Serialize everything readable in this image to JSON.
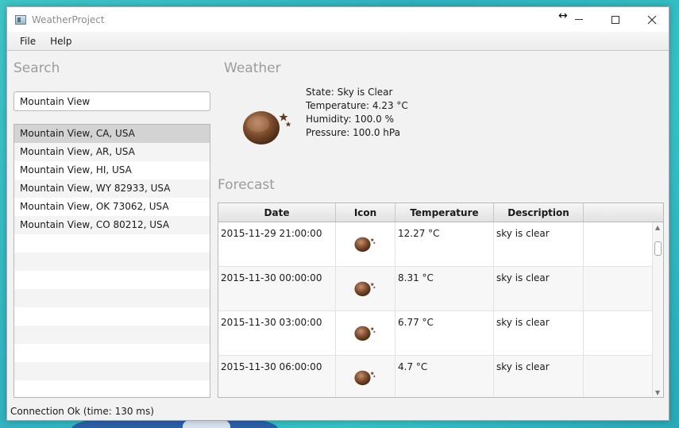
{
  "window": {
    "title": "WeatherProject",
    "resize_glyph": "↔"
  },
  "menu": {
    "items": [
      "File",
      "Help"
    ]
  },
  "search": {
    "title": "Search",
    "value": "Mountain View",
    "results": [
      "Mountain View, CA, USA",
      "Mountain View, AR, USA",
      "Mountain View, HI, USA",
      "Mountain View, WY 82933, USA",
      "Mountain View, OK 73062, USA",
      "Mountain View, CO 80212, USA"
    ],
    "selected_index": 0
  },
  "weather": {
    "title": "Weather",
    "icon": "moon-stars-icon",
    "state": "State: Sky is Clear",
    "temperature": "Temperature: 4.23 °C",
    "humidity": "Humidity: 100.0 %",
    "pressure": "Pressure: 100.0 hPa"
  },
  "forecast": {
    "title": "Forecast",
    "columns": [
      "Date",
      "Icon",
      "Temperature",
      "Description"
    ],
    "rows": [
      {
        "date": "2015-11-29 21:00:00",
        "icon": "moon-stars-icon",
        "temperature": "12.27 °C",
        "description": "sky is clear"
      },
      {
        "date": "2015-11-30 00:00:00",
        "icon": "moon-stars-icon",
        "temperature": "8.31 °C",
        "description": "sky is clear"
      },
      {
        "date": "2015-11-30 03:00:00",
        "icon": "moon-stars-icon",
        "temperature": "6.77 °C",
        "description": "sky is clear"
      },
      {
        "date": "2015-11-30 06:00:00",
        "icon": "moon-stars-icon",
        "temperature": "4.7 °C",
        "description": "sky is clear"
      }
    ]
  },
  "status": {
    "text": "Connection Ok (time: 130 ms)"
  },
  "colors": {
    "accent_background": "#3fc6c8",
    "selected_row": "#d3d3d3",
    "moon": "#7a4a2a"
  }
}
